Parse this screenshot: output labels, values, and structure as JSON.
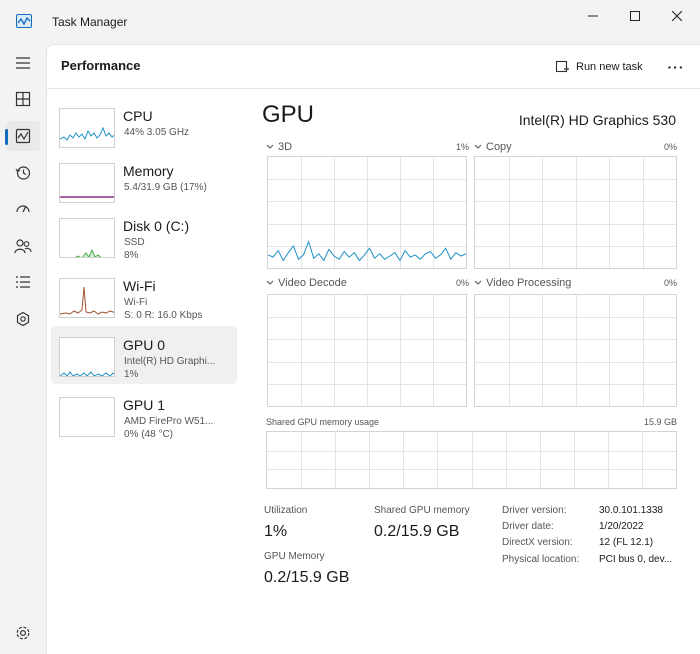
{
  "window": {
    "title": "Task Manager"
  },
  "nav": {
    "icons": [
      "hamburger-icon",
      "processes-icon",
      "performance-icon",
      "app-history-icon",
      "startup-icon",
      "users-icon",
      "details-icon",
      "services-icon",
      "settings-icon"
    ],
    "active": "performance"
  },
  "header": {
    "title": "Performance",
    "run_new_task": "Run new task",
    "more": "···"
  },
  "devices": [
    {
      "name": "CPU",
      "line2": "44% 3.05 GHz",
      "line3": "",
      "color": "#1e90c8"
    },
    {
      "name": "Memory",
      "line2": "5.4/31.9 GB (17%)",
      "line3": "",
      "color": "#8b2f8b"
    },
    {
      "name": "Disk 0 (C:)",
      "line2": "SSD",
      "line3": "8%",
      "color": "#4caf50"
    },
    {
      "name": "Wi-Fi",
      "line2": "Wi-Fi",
      "line3": "S: 0 R: 16.0 Kbps",
      "color": "#a0522d"
    },
    {
      "name": "GPU 0",
      "line2": "Intel(R) HD Graphi...",
      "line3": "1%",
      "color": "#1e90c8"
    },
    {
      "name": "GPU 1",
      "line2": "AMD FirePro W51...",
      "line3": "0% (48 °C)",
      "color": "#1e90c8"
    }
  ],
  "gpu": {
    "title": "GPU",
    "model": "Intel(R) HD Graphics 530",
    "engines": [
      {
        "name": "3D",
        "percent": "1%"
      },
      {
        "name": "Copy",
        "percent": "0%"
      },
      {
        "name": "Video Decode",
        "percent": "0%"
      },
      {
        "name": "Video Processing",
        "percent": "0%"
      }
    ],
    "shared_label": "Shared GPU memory usage",
    "shared_max": "15.9 GB",
    "stats": {
      "utilization_label": "Utilization",
      "utilization_value": "1%",
      "shared_mem_label": "Shared GPU memory",
      "shared_mem_value": "0.2/15.9 GB",
      "gpu_mem_label": "GPU Memory",
      "gpu_mem_value": "0.2/15.9 GB"
    },
    "info": [
      {
        "key": "Driver version:",
        "value": "30.0.101.1338"
      },
      {
        "key": "Driver date:",
        "value": "1/20/2022"
      },
      {
        "key": "DirectX version:",
        "value": "12 (FL 12.1)"
      },
      {
        "key": "Physical location:",
        "value": "PCI bus 0, dev..."
      }
    ]
  },
  "colors": {
    "accent": "#0f6cbd",
    "gpu_line": "#1e90c8",
    "grid": "#e4e4e4"
  }
}
